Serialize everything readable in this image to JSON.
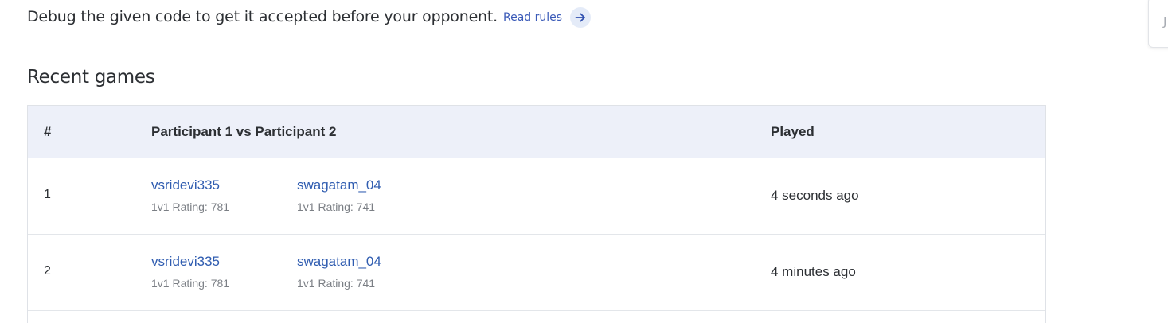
{
  "intro": {
    "text": "Debug the given code to get it accepted before your opponent.",
    "read_rules_label": "Read rules",
    "arrow_icon": "arrow-right-icon"
  },
  "side_widget": {
    "letter": "J"
  },
  "recent_games": {
    "title": "Recent games",
    "columns": [
      "#",
      "Participant 1 vs Participant 2",
      "Played"
    ],
    "rows": [
      {
        "num": "1",
        "p1_name": "vsridevi335",
        "p1_rating": "1v1 Rating: 781",
        "p2_name": "swagatam_04",
        "p2_rating": "1v1 Rating: 741",
        "played": "4 seconds ago"
      },
      {
        "num": "2",
        "p1_name": "vsridevi335",
        "p1_rating": "1v1 Rating: 781",
        "p2_name": "swagatam_04",
        "p2_rating": "1v1 Rating: 741",
        "played": "4 minutes ago"
      }
    ]
  },
  "colors": {
    "link": "#2f5cb0",
    "header_bg": "#edf0f9",
    "arrow_bg": "#e4ebf8"
  }
}
